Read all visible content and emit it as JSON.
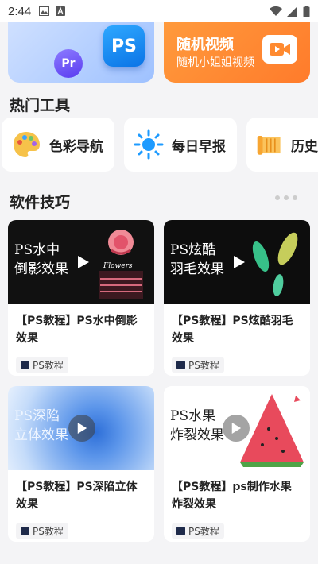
{
  "status_bar": {
    "time": "2:44"
  },
  "banners": [
    {
      "title": "",
      "subtitle": "",
      "badges": [
        "PS",
        "Pr"
      ]
    },
    {
      "title": "随机视频",
      "subtitle": "随机小姐姐视频"
    }
  ],
  "hot_tools": {
    "heading": "热门工具",
    "items": [
      {
        "label": "色彩导航",
        "icon": "palette-icon"
      },
      {
        "label": "每日早报",
        "icon": "sun-icon"
      },
      {
        "label": "历史",
        "icon": "scroll-icon"
      }
    ]
  },
  "tips": {
    "heading": "软件技巧",
    "cards": [
      {
        "thumb_text": "PS水中\n倒影效果",
        "title": "【PS教程】PS水中倒影效果",
        "tag": "PS教程",
        "theme": "dark"
      },
      {
        "thumb_text": "PS炫酷\n羽毛效果",
        "title": "【PS教程】PS炫酷羽毛效果",
        "tag": "PS教程",
        "theme": "dark"
      },
      {
        "thumb_text": "PS深陷\n立体效果",
        "title": "【PS教程】PS深陷立体效果",
        "tag": "PS教程",
        "theme": "blue"
      },
      {
        "thumb_text": "PS水果\n炸裂效果",
        "title": "【PS教程】ps制作水果炸裂效果",
        "tag": "PS教程",
        "theme": "light"
      }
    ]
  },
  "colors": {
    "accent_orange": "#ff8a30",
    "ps_blue": "#0b74e6"
  }
}
